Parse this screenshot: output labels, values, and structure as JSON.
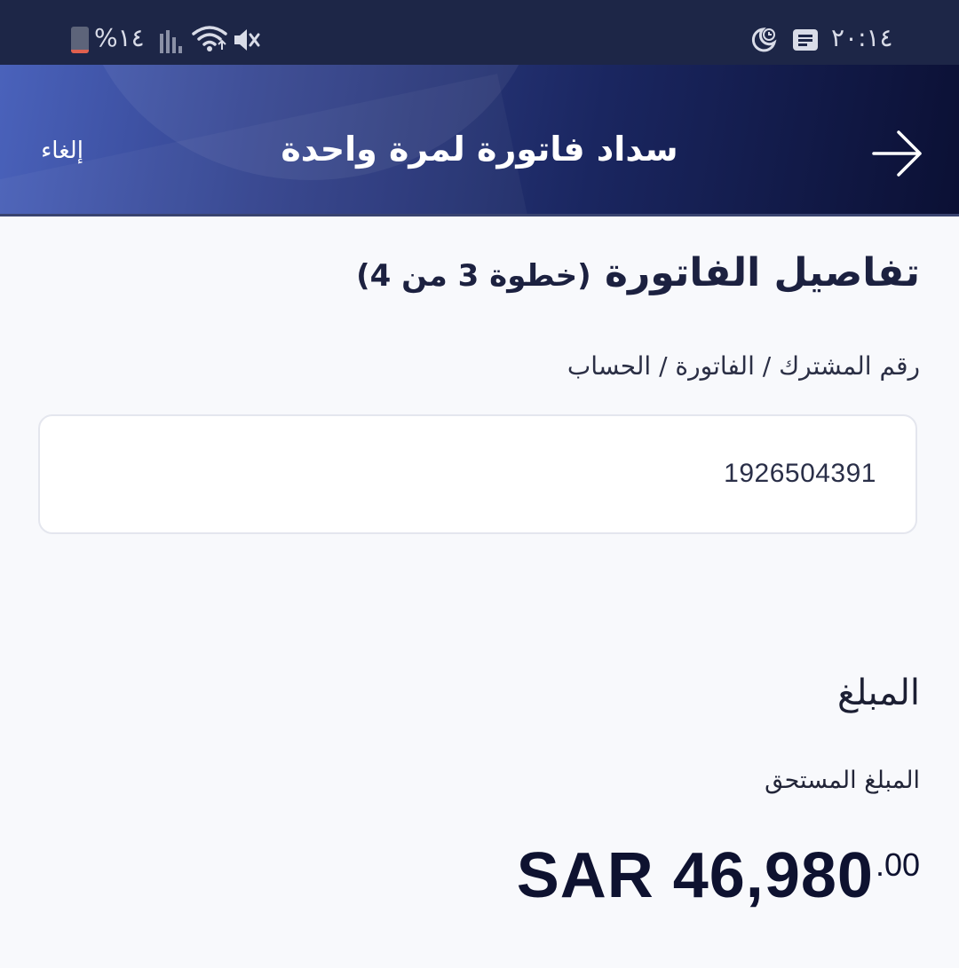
{
  "status_bar": {
    "time": "٢٠:١٤",
    "battery_percent": "%١٤",
    "icons": [
      "battery-icon",
      "signal-icon",
      "wifi-icon",
      "mute-icon",
      "message-icon",
      "do-not-disturb-icon"
    ]
  },
  "header": {
    "title": "سداد فاتورة لمرة واحدة",
    "cancel_label": "إلغاء",
    "back_icon": "arrow-right-icon"
  },
  "section": {
    "title": "تفاصيل الفاتورة",
    "step": "(خطوة 3 من 4)"
  },
  "account_field": {
    "label": "رقم المشترك / الفاتورة / الحساب",
    "value": "1926504391"
  },
  "amount": {
    "heading": "المبلغ",
    "due_label": "المبلغ المستحق",
    "main": "SAR 46,980",
    "decimal": ".00"
  },
  "colors": {
    "header_start": "#4a62bb",
    "header_end": "#0b1034",
    "status_bar": "#1d2647",
    "background": "#f8f9fc"
  }
}
